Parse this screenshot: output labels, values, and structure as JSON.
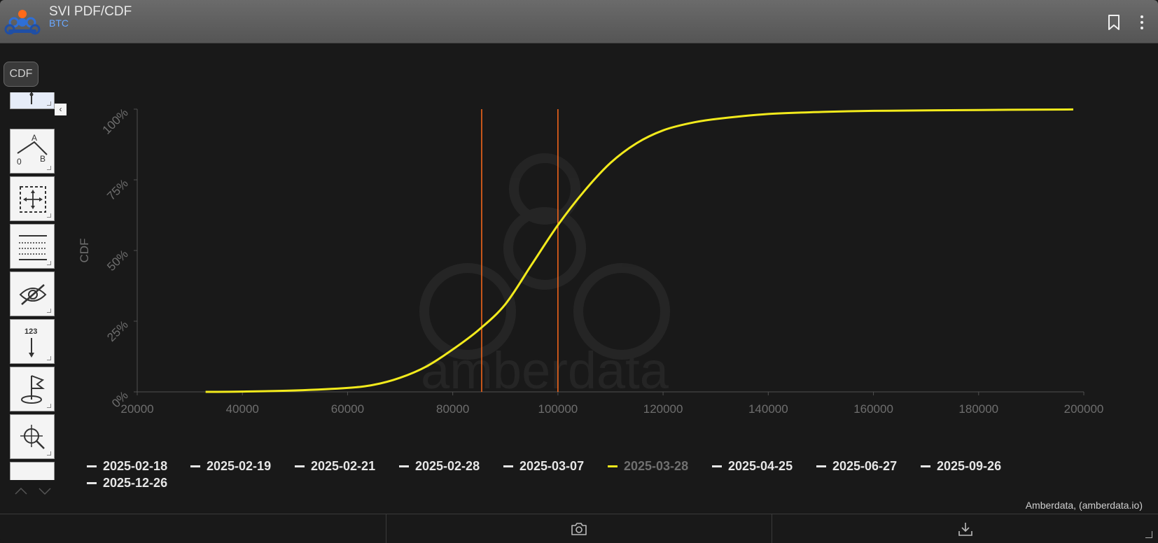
{
  "header": {
    "title": "SVI PDF/CDF",
    "subtitle": "BTC",
    "bookmark_icon": "bookmark-icon",
    "menu_icon": "kebab-menu-icon"
  },
  "mode_button": {
    "label": "CDF"
  },
  "toolbar": {
    "tools": [
      {
        "name": "crosshair-tool",
        "icon": "crosshair-line-icon"
      },
      {
        "name": "angle-tool",
        "icon": "angle-icon",
        "labels": [
          "A",
          "0",
          "B"
        ]
      },
      {
        "name": "move-zoom-tool",
        "icon": "dashed-move-icon"
      },
      {
        "name": "horizontal-lines-tool",
        "icon": "horizontal-lines-icon"
      },
      {
        "name": "hide-tool",
        "icon": "eye-slash-icon"
      },
      {
        "name": "sort-tool",
        "icon": "sort-123-icon",
        "labels": [
          "123"
        ]
      },
      {
        "name": "marker-tool",
        "icon": "flag-marker-icon"
      },
      {
        "name": "zoom-tool",
        "icon": "zoom-move-icon"
      }
    ],
    "collapse_icon": "chevron-left-icon"
  },
  "colors": {
    "curve": "#f2ea1c",
    "vertical_lines": "#ff6a1a",
    "axis": "#505050",
    "tick_text": "#6e6e6e",
    "background": "#191919",
    "subtitle": "#6aa8ff"
  },
  "chart_data": {
    "type": "line",
    "ylabel": "CDF",
    "xlim": [
      20000,
      200000
    ],
    "ylim": [
      0,
      1
    ],
    "x_ticks": [
      "20000",
      "40000",
      "60000",
      "80000",
      "100000",
      "120000",
      "140000",
      "160000",
      "180000",
      "200000"
    ],
    "y_ticks": [
      "0%",
      "25%",
      "50%",
      "75%",
      "100%"
    ],
    "vertical_lines": [
      85500,
      100000
    ],
    "series": [
      {
        "name": "2025-03-28",
        "points": [
          [
            33000,
            0.0
          ],
          [
            40000,
            0.001
          ],
          [
            50000,
            0.005
          ],
          [
            60000,
            0.014
          ],
          [
            65000,
            0.025
          ],
          [
            70000,
            0.05
          ],
          [
            75000,
            0.09
          ],
          [
            80000,
            0.15
          ],
          [
            85000,
            0.22
          ],
          [
            90000,
            0.31
          ],
          [
            95000,
            0.45
          ],
          [
            100000,
            0.59
          ],
          [
            105000,
            0.71
          ],
          [
            110000,
            0.81
          ],
          [
            115000,
            0.88
          ],
          [
            120000,
            0.925
          ],
          [
            125000,
            0.95
          ],
          [
            130000,
            0.965
          ],
          [
            140000,
            0.983
          ],
          [
            150000,
            0.99
          ],
          [
            160000,
            0.994
          ],
          [
            180000,
            0.997
          ],
          [
            198000,
            0.999
          ]
        ]
      }
    ],
    "legend": [
      {
        "label": "2025-02-18",
        "highlighted": false
      },
      {
        "label": "2025-02-19",
        "highlighted": false
      },
      {
        "label": "2025-02-21",
        "highlighted": false
      },
      {
        "label": "2025-02-28",
        "highlighted": false
      },
      {
        "label": "2025-03-07",
        "highlighted": false
      },
      {
        "label": "2025-03-28",
        "highlighted": true
      },
      {
        "label": "2025-04-25",
        "highlighted": false
      },
      {
        "label": "2025-06-27",
        "highlighted": false
      },
      {
        "label": "2025-09-26",
        "highlighted": false
      },
      {
        "label": "2025-12-26",
        "highlighted": false
      }
    ],
    "grid": false,
    "legend_position": "bottom"
  },
  "credit": "Amberdata, (amberdata.io)",
  "watermark": "amberdata",
  "footer": {
    "camera_icon": "camera-icon",
    "download_icon": "download-icon"
  }
}
